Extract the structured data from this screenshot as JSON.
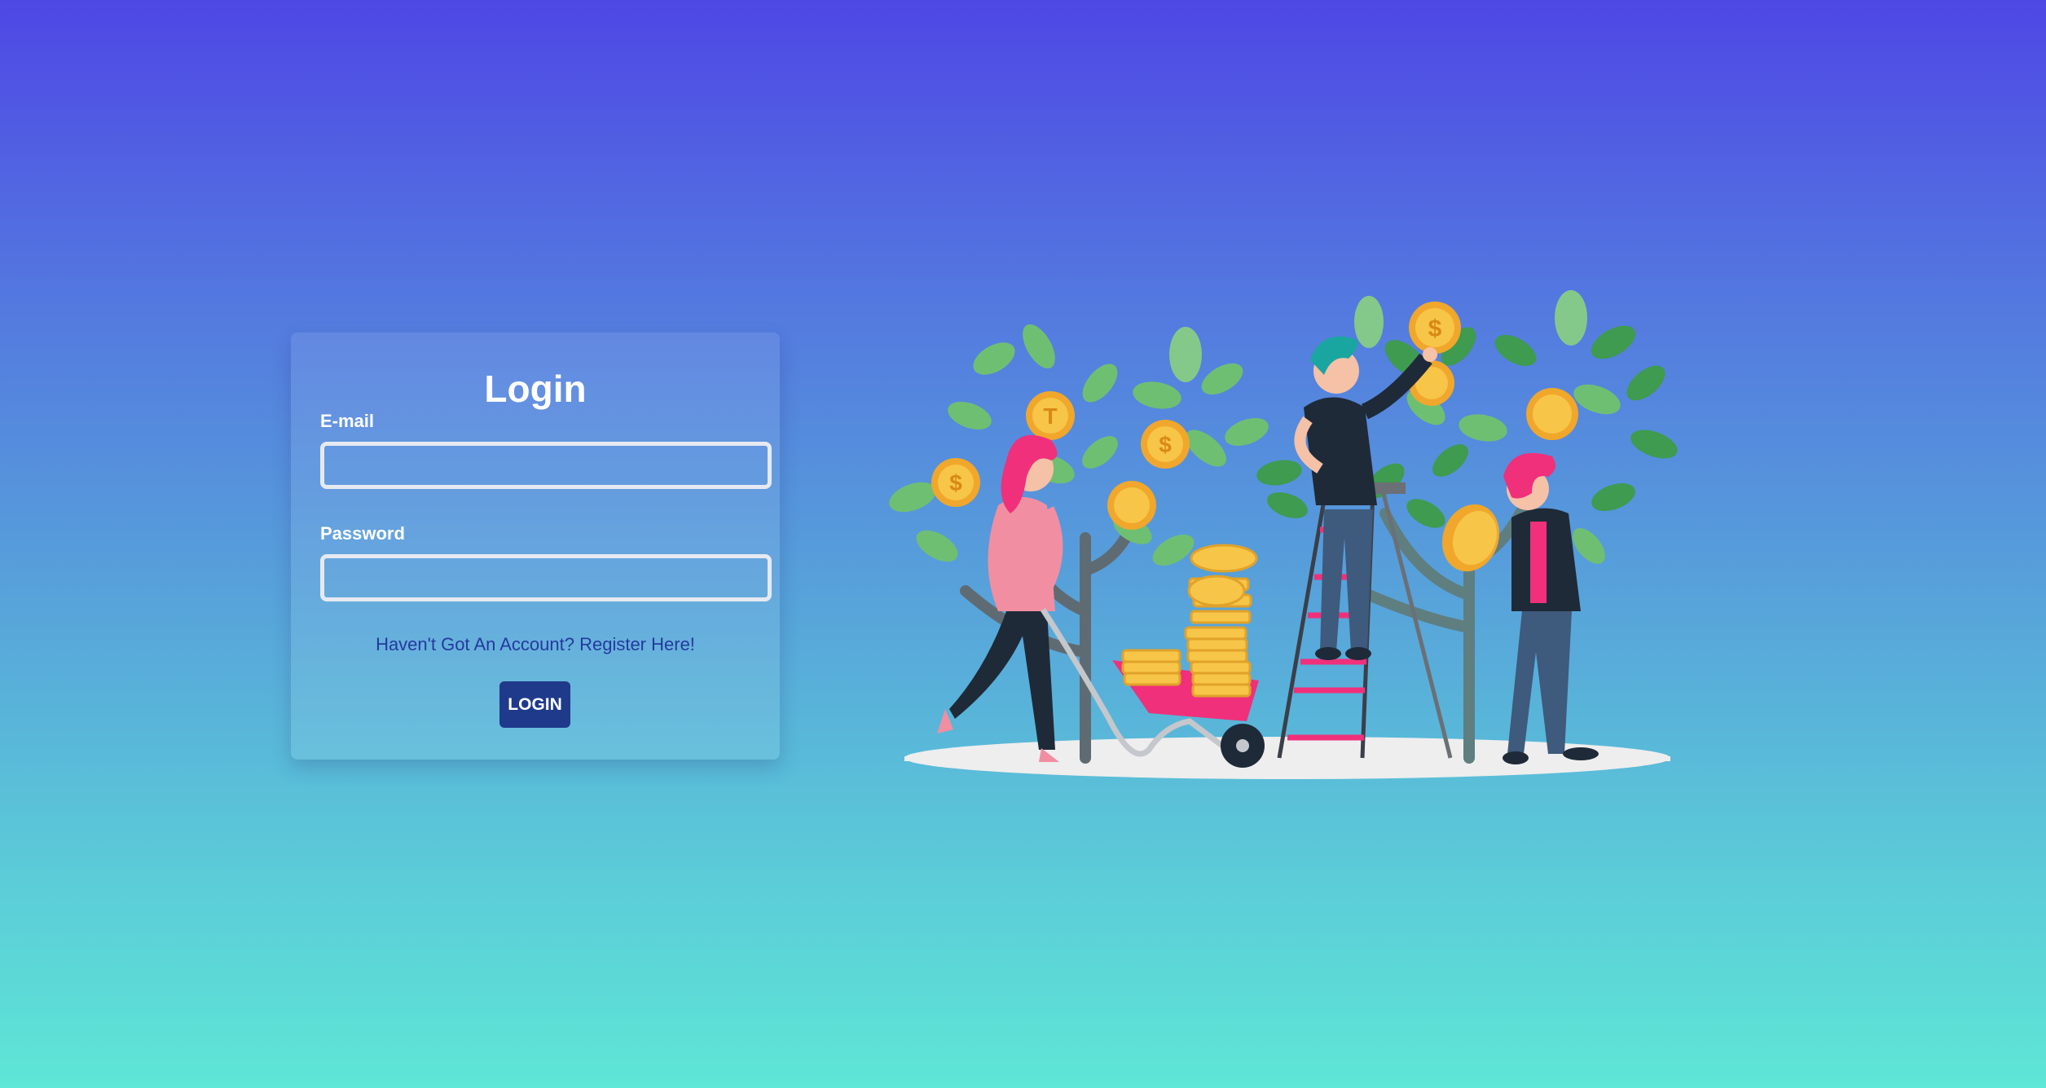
{
  "form": {
    "title": "Login",
    "email_label": "E-mail",
    "email_value": "",
    "password_label": "Password",
    "password_value": "",
    "register_link": "Haven't Got An Account? Register Here!",
    "login_button": "LOGIN"
  },
  "colors": {
    "gradient_top": "#4e47e5",
    "gradient_bottom": "#5ee6d6",
    "button_bg": "#1f3a8a",
    "link": "#243a9e"
  },
  "illustration": {
    "icon": "money-tree-people-illustration",
    "coin_symbols": [
      "$",
      "$",
      "T",
      "$",
      "$"
    ]
  }
}
